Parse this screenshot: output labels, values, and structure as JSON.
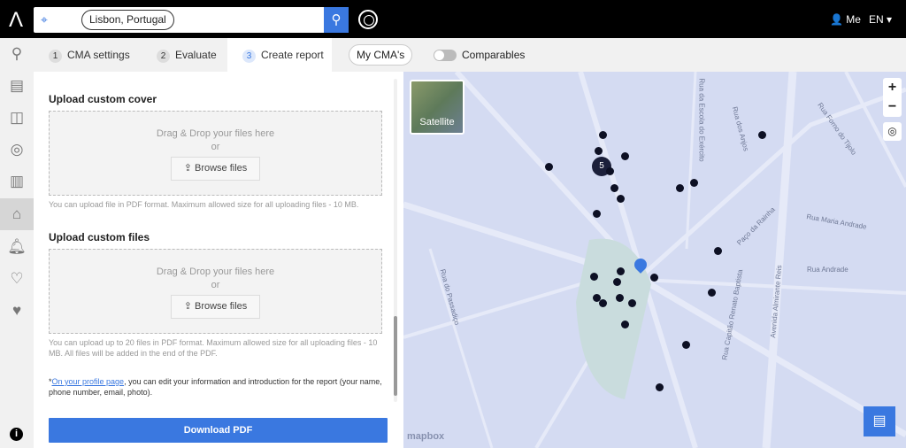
{
  "header": {
    "search_value": "Lisbon, Portugal",
    "me_label": "Me",
    "language": "EN"
  },
  "tabs": [
    {
      "num": "1",
      "label": "CMA settings"
    },
    {
      "num": "2",
      "label": "Evaluate"
    },
    {
      "num": "3",
      "label": "Create report",
      "active": true
    }
  ],
  "my_cmas": "My CMA's",
  "comparables": {
    "label": "Comparables",
    "enabled": false
  },
  "panel": {
    "cover": {
      "title": "Upload custom cover",
      "drop": "Drag & Drop your files here",
      "or": "or",
      "browse": "Browse files",
      "note": "You can upload file in PDF format. Maximum allowed size for all uploading files - 10 MB."
    },
    "files": {
      "title": "Upload custom files",
      "drop": "Drag & Drop your files here",
      "or": "or",
      "browse": "Browse files",
      "note": "You can upload up to 20 files in PDF format. Maximum allowed size for all uploading files - 10 MB. All files will be added in the end of the PDF."
    },
    "profile_link": "On your profile page",
    "profile_text": ", you can edit your information and introduction for the report (your name, phone number, email, photo).",
    "download": "Download PDF"
  },
  "map": {
    "satellite": "Satellite",
    "cluster_count": "5",
    "attribution": "mapbox",
    "streets": [
      "Paço da Rainha",
      "Rua Maria Andrade",
      "Rua Andrade",
      "Rua do Passadiço",
      "Rua Capitão Renato Baptista",
      "Avenida Almirante Reis",
      "Rua da Escola do Exército",
      "Rua dos Anjos",
      "Rua Forno do Tijolo"
    ]
  },
  "colors": {
    "accent": "#3a78e0",
    "map_bg": "#d4dbf2",
    "marker": "#0d1024"
  }
}
